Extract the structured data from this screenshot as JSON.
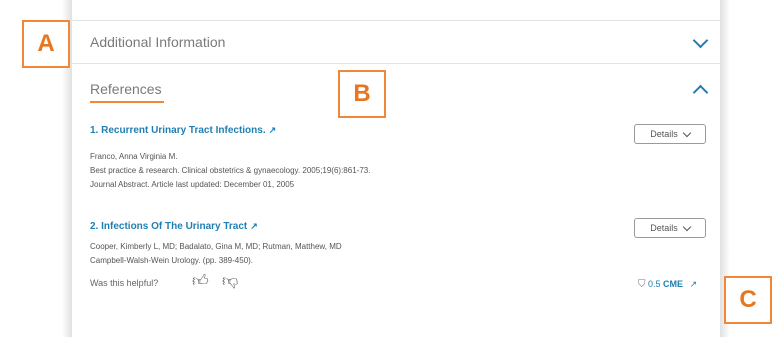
{
  "sections": {
    "additional_info": {
      "title": "Additional Information"
    },
    "references": {
      "title": "References"
    }
  },
  "references": [
    {
      "title": "1. Recurrent Urinary Tract Infections.",
      "lines": [
        "Franco, Anna Virginia M.",
        "Best practice & research. Clinical obstetrics & gynaecology. 2005;19(6):861-73.",
        "Journal Abstract. Article last updated: December 01, 2005"
      ],
      "details_label": "Details"
    },
    {
      "title": "2. Infections Of The Urinary Tract",
      "lines": [
        "Cooper, Kimberly L, MD; Badalato, Gina M, MD; Rutman, Matthew, MD",
        "Campbell-Walsh-Wein Urology. (pp. 389-450)."
      ],
      "details_label": "Details"
    }
  ],
  "feedback": {
    "question": "Was this helpful?"
  },
  "cme": {
    "amount": "0.5",
    "label": "CME"
  },
  "labels": {
    "a": "A",
    "b": "B",
    "c": "C"
  },
  "colors": {
    "accent": "#f0873a",
    "link": "#1f7fb3"
  },
  "icons": {
    "thumbs_up": "thumbs-up-icon",
    "thumbs_down": "thumbs-down-icon",
    "shield": "shield-icon",
    "external": "external-link-icon"
  }
}
